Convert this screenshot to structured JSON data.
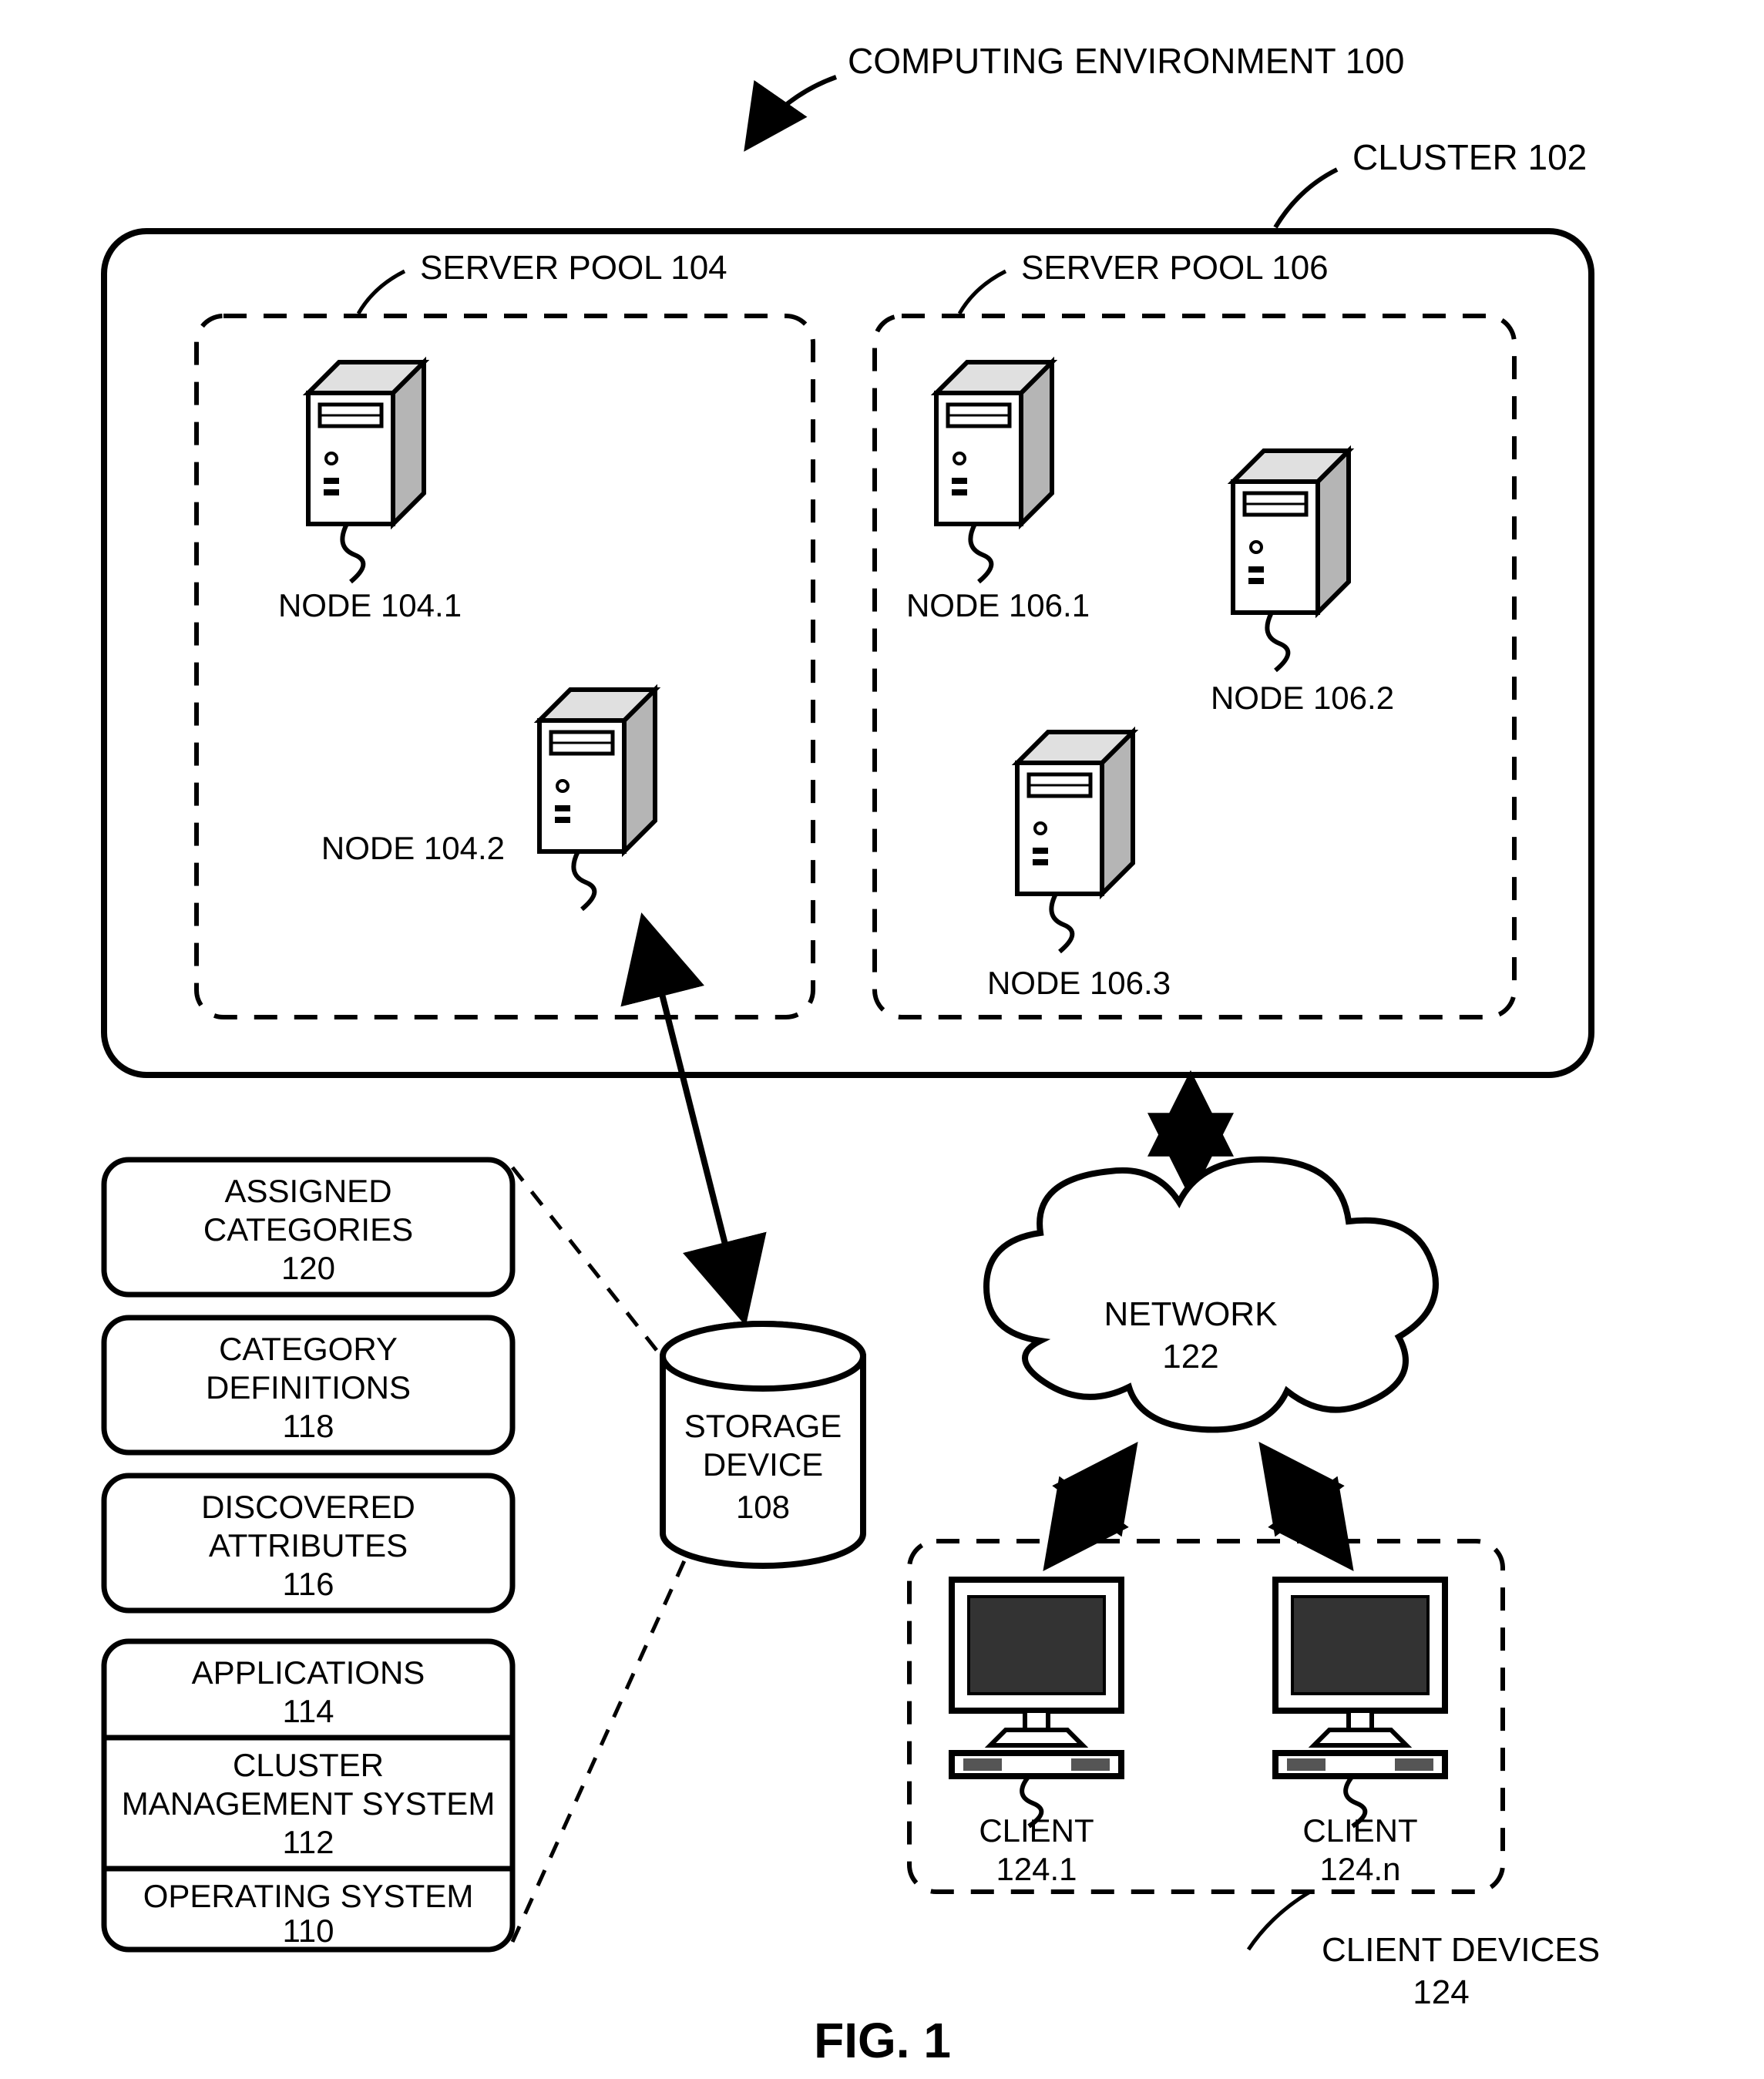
{
  "labels": {
    "computing_env": "COMPUTING ENVIRONMENT 100",
    "cluster": "CLUSTER 102",
    "server_pool_left": "SERVER POOL 104",
    "server_pool_right": "SERVER POOL 106",
    "node_104_1": "NODE 104.1",
    "node_104_2": "NODE 104.2",
    "node_106_1": "NODE 106.1",
    "node_106_2": "NODE 106.2",
    "node_106_3": "NODE 106.3",
    "storage_device_l1": "STORAGE",
    "storage_device_l2": "DEVICE",
    "storage_device_l3": "108",
    "assigned_cat_l1": "ASSIGNED",
    "assigned_cat_l2": "CATEGORIES",
    "assigned_cat_l3": "120",
    "cat_def_l1": "CATEGORY",
    "cat_def_l2": "DEFINITIONS",
    "cat_def_l3": "118",
    "disc_attr_l1": "DISCOVERED",
    "disc_attr_l2": "ATTRIBUTES",
    "disc_attr_l3": "116",
    "apps_l1": "APPLICATIONS",
    "apps_l2": "114",
    "cms_l1": "CLUSTER",
    "cms_l2": "MANAGEMENT SYSTEM",
    "cms_l3": "112",
    "os_l1": "OPERATING SYSTEM",
    "os_l2": "110",
    "network_l1": "NETWORK",
    "network_l2": "122",
    "client_1_l1": "CLIENT",
    "client_1_l2": "124.1",
    "client_n_l1": "CLIENT",
    "client_n_l2": "124.n",
    "client_devices_l1": "CLIENT DEVICES",
    "client_devices_l2": "124",
    "fig": "FIG. 1"
  }
}
